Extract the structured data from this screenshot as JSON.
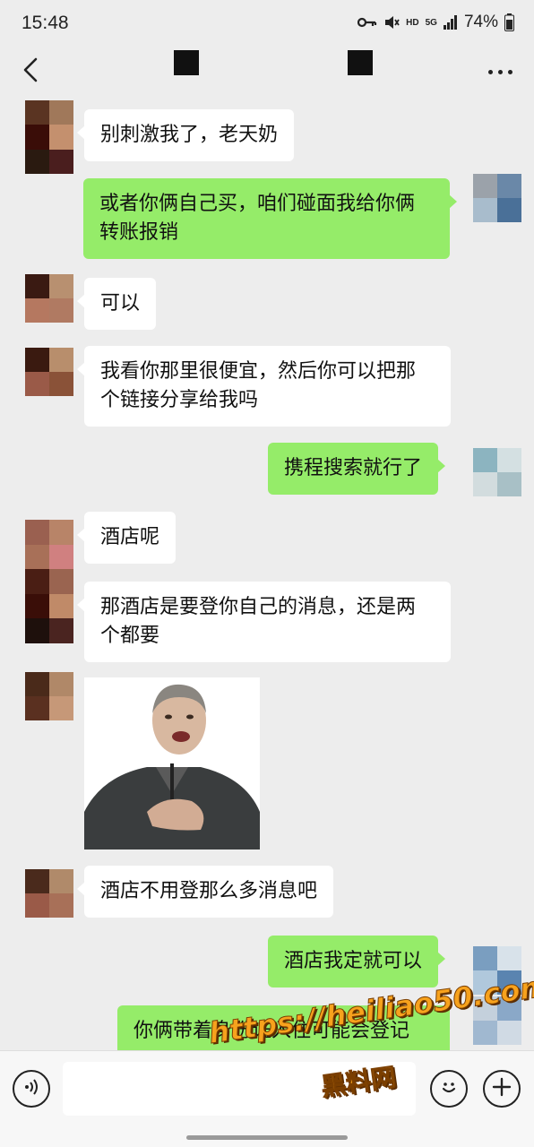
{
  "status_bar": {
    "time": "15:48",
    "network_hd": "HD",
    "network_5g": "5G",
    "battery_percent": "74%",
    "icons": [
      "vpn-key-icon",
      "mute-icon",
      "signal-icon",
      "battery-icon"
    ]
  },
  "nav": {
    "back_icon": "chevron-left-icon",
    "more_icon": "ellipsis-icon"
  },
  "messages": [
    {
      "side": "in",
      "text": "别刺激我了，老天奶"
    },
    {
      "side": "out",
      "line1": "或者你俩自己买，咱们碰面我给你俩",
      "line2": "转账报销"
    },
    {
      "side": "in",
      "text": "可以"
    },
    {
      "side": "in",
      "line1": "我看你那里很便宜，然后你可以把那",
      "line2": "个链接分享给我吗"
    },
    {
      "side": "out",
      "text": "携程搜索就行了"
    },
    {
      "side": "in",
      "text": "酒店呢"
    },
    {
      "side": "in",
      "line1": "那酒店是要登你自己的消息，还是两",
      "line2": "个都要"
    },
    {
      "side": "in",
      "type": "sticker"
    },
    {
      "side": "in",
      "text": "酒店不用登那么多消息吧"
    },
    {
      "side": "out",
      "text": "酒店我定就可以"
    },
    {
      "side": "out",
      "text": "你俩带着身份证入住可能会登记"
    }
  ],
  "input_bar": {
    "placeholder": "",
    "icons": [
      "voice-icon",
      "emoji-icon",
      "plus-icon"
    ]
  },
  "watermark": {
    "url": "https://heiliao50.com",
    "text": "黑料网"
  },
  "colors": {
    "background": "#ededed",
    "bubble_in": "#ffffff",
    "bubble_out": "#95ec69",
    "watermark": "#f7a21d"
  }
}
